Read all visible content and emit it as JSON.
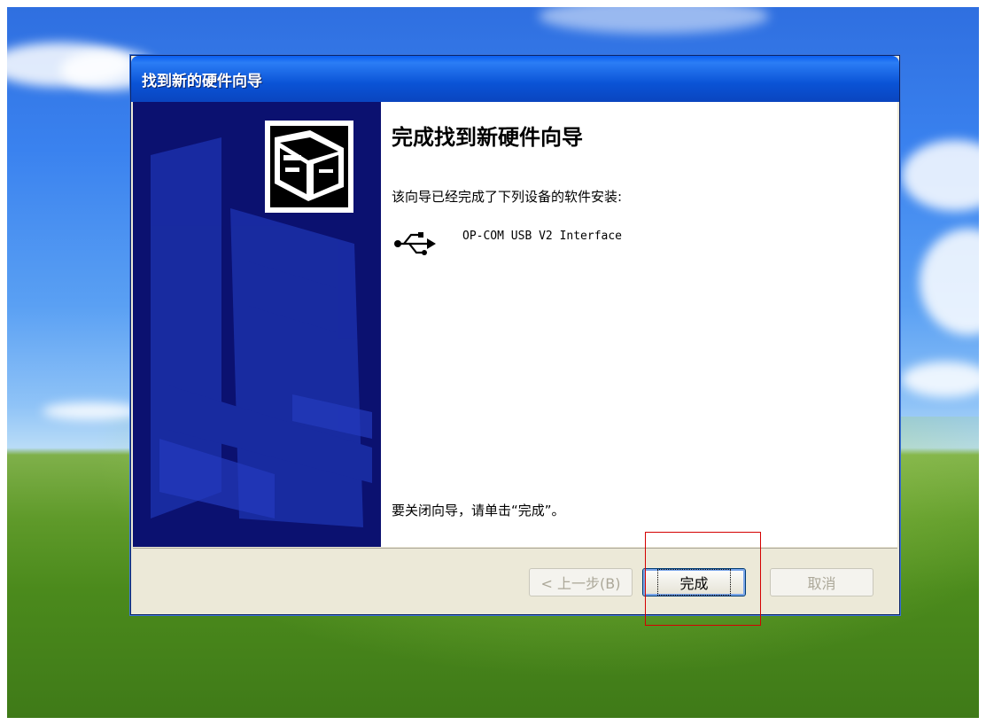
{
  "window": {
    "title": "找到新的硬件向导"
  },
  "content": {
    "heading": "完成找到新硬件向导",
    "description": "该向导已经完成了下列设备的软件安装:",
    "device_name": "OP-COM USB V2 Interface",
    "device_icon": "usb-icon",
    "close_hint": "要关闭向导，请单击“完成”。"
  },
  "buttons": {
    "back": "< 上一步(B)",
    "finish": "完成",
    "cancel": "取消"
  },
  "colors": {
    "titlebar": "#0a53d6",
    "left_panel": "#0a0e6e",
    "highlight": "#d40000"
  }
}
